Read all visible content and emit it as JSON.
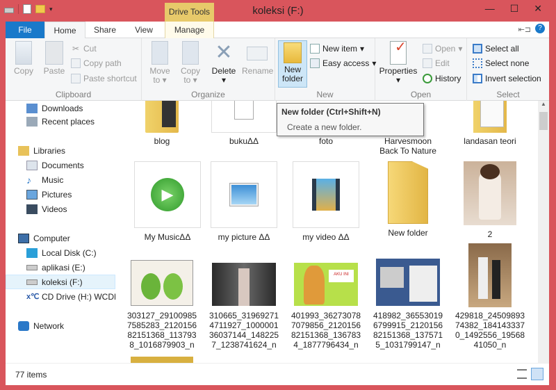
{
  "window": {
    "title": "koleksi (F:)",
    "contextual_tab": "Drive Tools"
  },
  "tabs": [
    {
      "label": "File"
    },
    {
      "label": "Home"
    },
    {
      "label": "Share"
    },
    {
      "label": "View"
    },
    {
      "label": "Manage"
    }
  ],
  "ribbon": {
    "clipboard": {
      "label": "Clipboard",
      "copy": "Copy",
      "paste": "Paste",
      "cut": "Cut",
      "copy_path": "Copy path",
      "paste_shortcut": "Paste shortcut"
    },
    "organize": {
      "label": "Organize",
      "move_to": "Move",
      "move_to2": "to",
      "copy_to": "Copy",
      "copy_to2": "to",
      "delete": "Delete",
      "rename": "Rename"
    },
    "new": {
      "label": "New",
      "new_folder": "New",
      "new_folder2": "folder",
      "new_item": "New item",
      "easy_access": "Easy access"
    },
    "open": {
      "label": "Open",
      "properties": "Properties",
      "open": "Open",
      "edit": "Edit",
      "history": "History"
    },
    "select": {
      "label": "Select",
      "select_all": "Select all",
      "select_none": "Select none",
      "invert": "Invert selection"
    }
  },
  "tooltip": {
    "title": "New folder (Ctrl+Shift+N)",
    "desc": "Create a new folder."
  },
  "sidebar": {
    "downloads": "Downloads",
    "recent": "Recent places",
    "libraries": "Libraries",
    "documents": "Documents",
    "music": "Music",
    "pictures": "Pictures",
    "videos": "Videos",
    "computer": "Computer",
    "local_disk": "Local Disk (C:)",
    "aplikasi": "aplikasi (E:)",
    "koleksi": "koleksi (F:)",
    "cd_drive": "CD Drive (H:) WCDM",
    "network": "Network"
  },
  "items": {
    "blog": "blog",
    "buku": "bukuΔΔ",
    "foto": "foto",
    "harvesmoon1": "Harvesmoon",
    "harvesmoon2": "Back To Nature",
    "landasan": "landasan teori",
    "mymusic": "My MusicΔΔ",
    "mypicture": "my picture ΔΔ",
    "myvideo": "my video ΔΔ",
    "newfolder": "New folder",
    "two": "2",
    "f1a": "303127_29100985",
    "f1b": "7585283_2120156",
    "f1c": "82151368_113793",
    "f1d": "8_1016879903_n",
    "f2a": "310665_31969271",
    "f2b": "4711927_1000001",
    "f2c": "36037144_148225",
    "f2d": "7_1238741624_n",
    "f3a": "401993_36273078",
    "f3b": "7079856_2120156",
    "f3c": "82151368_136783",
    "f3d": "4_1877796434_n",
    "f4a": "418982_36553019",
    "f4b": "6799915_2120156",
    "f4c": "82151368_137571",
    "f4d": "5_1031799147_n",
    "f5a": "429818_24509893",
    "f5b": "74382_184143337",
    "f5c": "0_1492556_19568",
    "f5d": "41050_n"
  },
  "status": {
    "count": "77 items"
  }
}
